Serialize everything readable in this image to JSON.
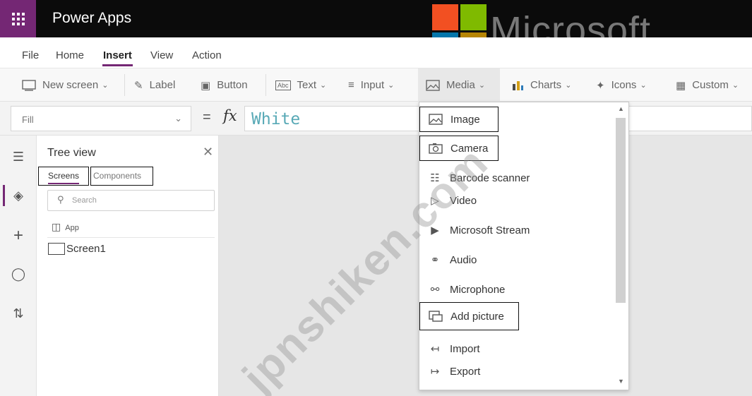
{
  "app": {
    "title": "Power Apps"
  },
  "logo": {
    "text": "Microsoft",
    "colors": [
      "#f25022",
      "#7fba00",
      "#00a4ef",
      "#ffb900"
    ]
  },
  "menu": [
    "File",
    "Home",
    "Insert",
    "View",
    "Action"
  ],
  "active_menu": "Insert",
  "ribbon": {
    "new_screen": "New screen",
    "label": "Label",
    "button": "Button",
    "text": "Text",
    "input": "Input",
    "media": "Media",
    "charts": "Charts",
    "icons": "Icons",
    "custom": "Custom"
  },
  "formula": {
    "property": "Fill",
    "fx": "fx",
    "value": "White"
  },
  "tree": {
    "title": "Tree view",
    "tab_screens": "Screens",
    "tab_components": "Components",
    "search_placeholder": "Search",
    "app": "App",
    "screen1": "Screen1"
  },
  "media_menu": [
    {
      "label": "Image",
      "icon": "image-icon"
    },
    {
      "label": "Camera",
      "icon": "camera-icon"
    },
    {
      "label": "Barcode scanner",
      "icon": "barcode-icon"
    },
    {
      "label": "Video",
      "icon": "video-icon"
    },
    {
      "label": "Microsoft Stream",
      "icon": "stream-icon"
    },
    {
      "label": "Audio",
      "icon": "headphones-icon"
    },
    {
      "label": "Microphone",
      "icon": "microphone-icon"
    },
    {
      "label": "Add picture",
      "icon": "add-picture-icon"
    },
    {
      "label": "Import",
      "icon": "import-icon"
    },
    {
      "label": "Export",
      "icon": "export-icon"
    }
  ],
  "watermark": "jpnshiken.com",
  "colors": {
    "accent": "#742774",
    "formula_text": "#58a9b6"
  }
}
